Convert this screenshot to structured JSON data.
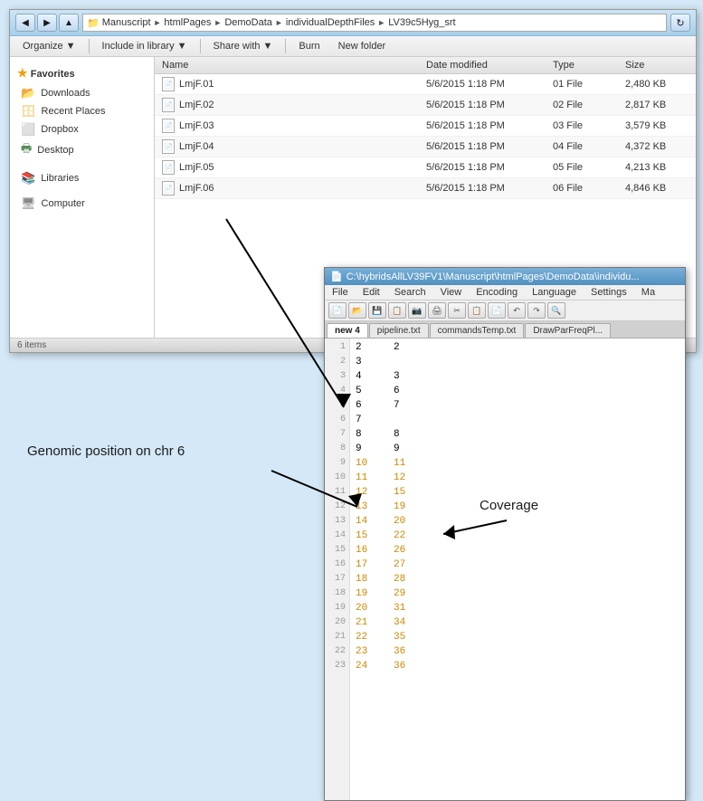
{
  "explorer": {
    "title": "LV39c5Hyg_srt",
    "address": {
      "parts": [
        "Manuscript",
        "htmlPages",
        "DemoData",
        "individualDepthFiles",
        "LV39c5Hyg_srt"
      ]
    },
    "toolbar": {
      "organize": "Organize",
      "include_library": "Include in library",
      "share_with": "Share with",
      "burn": "Burn",
      "new_folder": "New folder"
    },
    "columns": {
      "name": "Name",
      "date_modified": "Date modified",
      "type": "Type",
      "size": "Size"
    },
    "files": [
      {
        "name": "LmjF.01",
        "date": "5/6/2015 1:18 PM",
        "type": "01 File",
        "size": "2,480 KB"
      },
      {
        "name": "LmjF.02",
        "date": "5/6/2015 1:18 PM",
        "type": "02 File",
        "size": "2,817 KB"
      },
      {
        "name": "LmjF.03",
        "date": "5/6/2015 1:18 PM",
        "type": "03 File",
        "size": "3,579 KB"
      },
      {
        "name": "LmjF.04",
        "date": "5/6/2015 1:18 PM",
        "type": "04 File",
        "size": "4,372 KB"
      },
      {
        "name": "LmjF.05",
        "date": "5/6/2015 1:18 PM",
        "type": "05 File",
        "size": "4,213 KB"
      },
      {
        "name": "LmjF.06",
        "date": "5/6/2015 1:18 PM",
        "type": "06 File",
        "size": "4,846 KB"
      }
    ],
    "sidebar": {
      "favorites_label": "Favorites",
      "downloads": "Downloads",
      "recent_places": "Recent Places",
      "dropbox": "Dropbox",
      "desktop": "Desktop",
      "libraries_label": "Libraries",
      "computer_label": "Computer"
    }
  },
  "notepad": {
    "title": "C:\\hybridsAllLV39FV1\\Manuscript\\htmlPages\\DemoData\\individu...",
    "menu": [
      "File",
      "Edit",
      "Search",
      "View",
      "Encoding",
      "Language",
      "Settings",
      "Ma"
    ],
    "tabs": [
      "new 4",
      "pipeline.txt",
      "commandsTemp.txt",
      "DrawParFreqPl..."
    ],
    "data_rows": [
      {
        "pos": "2",
        "cov": "2"
      },
      {
        "pos": "3",
        "cov": ""
      },
      {
        "pos": "4",
        "cov": "3"
      },
      {
        "pos": "5",
        "cov": "6"
      },
      {
        "pos": "6",
        "cov": "7"
      },
      {
        "pos": "7",
        "cov": ""
      },
      {
        "pos": "8",
        "cov": "8"
      },
      {
        "pos": "9",
        "cov": "9"
      },
      {
        "pos": "10",
        "cov": "11"
      },
      {
        "pos": "11",
        "cov": "12"
      },
      {
        "pos": "12",
        "cov": "15"
      },
      {
        "pos": "13",
        "cov": "19"
      },
      {
        "pos": "14",
        "cov": "20"
      },
      {
        "pos": "15",
        "cov": "22"
      },
      {
        "pos": "16",
        "cov": "26"
      },
      {
        "pos": "17",
        "cov": "27"
      },
      {
        "pos": "18",
        "cov": "28"
      },
      {
        "pos": "19",
        "cov": "29"
      },
      {
        "pos": "20",
        "cov": "31"
      },
      {
        "pos": "21",
        "cov": "34"
      },
      {
        "pos": "22",
        "cov": "35"
      },
      {
        "pos": "23",
        "cov": "36"
      },
      {
        "pos": "24",
        "cov": "36"
      }
    ]
  },
  "annotations": {
    "genomic_position": "Genomic position on chr 6",
    "coverage": "Coverage"
  }
}
